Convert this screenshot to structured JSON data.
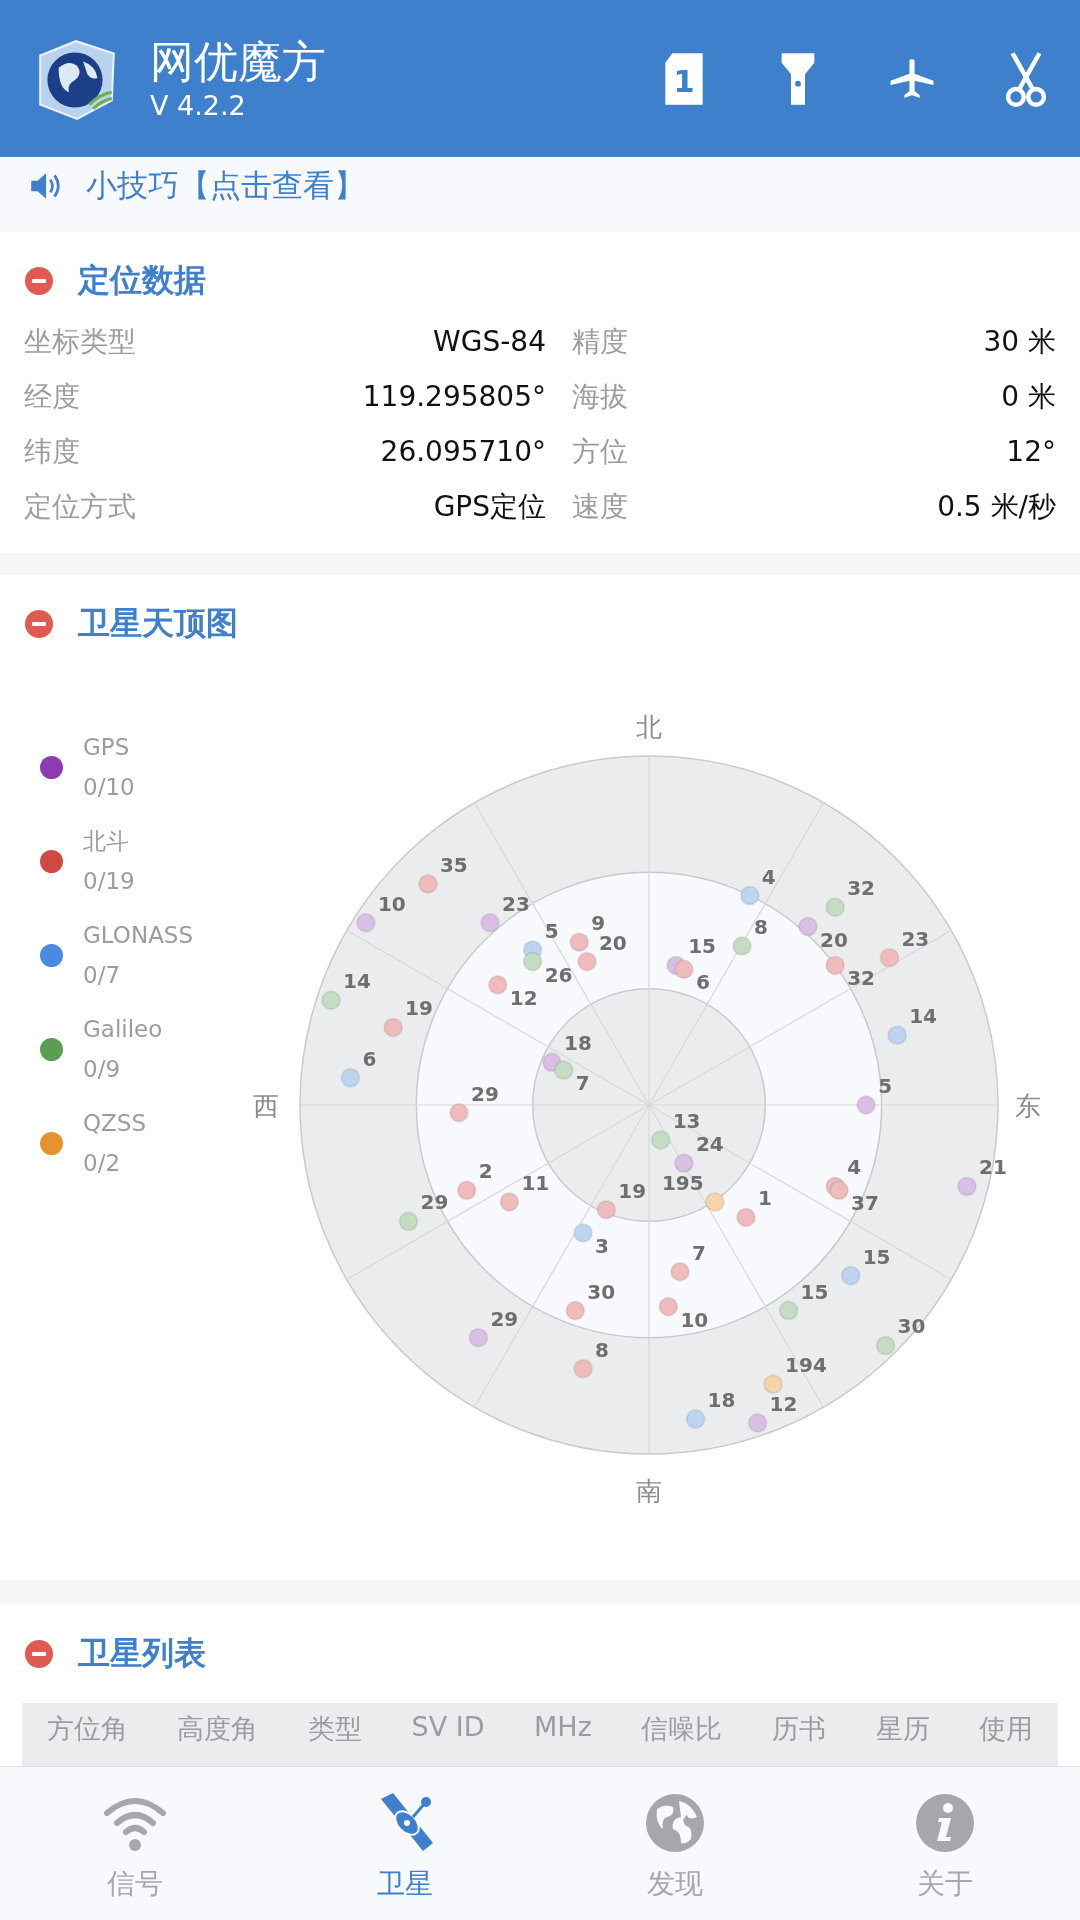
{
  "app": {
    "title": "网优魔方",
    "version": "V 4.2.2",
    "sim_label": "1"
  },
  "tip": {
    "text": "小技巧【点击查看】"
  },
  "location": {
    "title": "定位数据",
    "expanded": true,
    "rows": [
      {
        "label": "坐标类型",
        "value": "WGS-84",
        "label_2": "精度",
        "value_2": "30 米"
      },
      {
        "label": "经度",
        "value": "119.295805°",
        "label_2": "海拔",
        "value_2": "0 米"
      },
      {
        "label": "纬度",
        "value": "26.095710°",
        "label_2": "方位",
        "value_2": "12°"
      },
      {
        "label": "定位方式",
        "value": "GPS定位",
        "label_2": "速度",
        "value_2": "0.5 米/秒"
      }
    ]
  },
  "skyplot": {
    "title": "卫星天顶图",
    "expanded": true,
    "compass": {
      "north": "北",
      "east": "东",
      "south": "南",
      "west": "西"
    },
    "legend": [
      {
        "name": "GPS",
        "count": "0/10",
        "color": "#8e3ab0"
      },
      {
        "name": "北斗",
        "count": "0/19",
        "color": "#d04a44"
      },
      {
        "name": "GLONASS",
        "count": "0/7",
        "color": "#4a8ae0"
      },
      {
        "name": "Galileo",
        "count": "0/9",
        "color": "#5a9e52"
      },
      {
        "name": "QZSS",
        "count": "0/2",
        "color": "#e8912f"
      }
    ],
    "satellites": [
      {
        "label": "10",
        "color": "#d9bfe3"
      },
      {
        "label": "23",
        "color": "#d9bfe3"
      },
      {
        "label": "15",
        "color": "#d9bfe3"
      },
      {
        "label": "20",
        "color": "#d9bfe3"
      },
      {
        "label": "18",
        "color": "#d9bfe3"
      },
      {
        "label": "5",
        "color": "#d9bfe3"
      },
      {
        "label": "24",
        "color": "#d9bfe3"
      },
      {
        "label": "21",
        "color": "#d9bfe3"
      },
      {
        "label": "29",
        "color": "#d9bfe3"
      },
      {
        "label": "12",
        "color": "#d9bfe3"
      },
      {
        "label": "35",
        "color": "#efbcbb"
      },
      {
        "label": "19",
        "color": "#efbcbb"
      },
      {
        "label": "12",
        "color": "#efbcbb"
      },
      {
        "label": "9",
        "color": "#efbcbb"
      },
      {
        "label": "20",
        "color": "#efbcbb"
      },
      {
        "label": "6",
        "color": "#efbcbb"
      },
      {
        "label": "32",
        "color": "#efbcbb"
      },
      {
        "label": "23",
        "color": "#efbcbb"
      },
      {
        "label": "29",
        "color": "#efbcbb"
      },
      {
        "label": "2",
        "color": "#efbcbb"
      },
      {
        "label": "11",
        "color": "#efbcbb"
      },
      {
        "label": "19",
        "color": "#efbcbb"
      },
      {
        "label": "1",
        "color": "#efbcbb"
      },
      {
        "label": "4",
        "color": "#efbcbb"
      },
      {
        "label": "37",
        "color": "#efbcbb"
      },
      {
        "label": "7",
        "color": "#efbcbb"
      },
      {
        "label": "10",
        "color": "#efbcbb"
      },
      {
        "label": "30",
        "color": "#efbcbb"
      },
      {
        "label": "8",
        "color": "#efbcbb"
      },
      {
        "label": "4",
        "color": "#bcd4f2"
      },
      {
        "label": "5",
        "color": "#bcd4f2"
      },
      {
        "label": "14",
        "color": "#bcd4f2"
      },
      {
        "label": "6",
        "color": "#bcd4f2"
      },
      {
        "label": "3",
        "color": "#bcd4f2"
      },
      {
        "label": "15",
        "color": "#bcd4f2"
      },
      {
        "label": "18",
        "color": "#bcd4f2"
      },
      {
        "label": "32",
        "color": "#c4dcc0"
      },
      {
        "label": "8",
        "color": "#c4dcc0"
      },
      {
        "label": "26",
        "color": "#c4dcc0"
      },
      {
        "label": "14",
        "color": "#c4dcc0"
      },
      {
        "label": "7",
        "color": "#c4dcc0"
      },
      {
        "label": "13",
        "color": "#c4dcc0"
      },
      {
        "label": "29",
        "color": "#c4dcc0"
      },
      {
        "label": "15",
        "color": "#c4dcc0"
      },
      {
        "label": "30",
        "color": "#c4dcc0"
      },
      {
        "label": "195",
        "color": "#f5d3ad"
      },
      {
        "label": "194",
        "color": "#f5d3ad"
      }
    ]
  },
  "satellite_list": {
    "title": "卫星列表",
    "expanded": true,
    "columns": [
      "方位角",
      "高度角",
      "类型",
      "SV ID",
      "MHz",
      "信噪比",
      "历书",
      "星历",
      "使用"
    ]
  },
  "bottom_nav": [
    {
      "label": "信号",
      "kind": "wifi",
      "selected": false
    },
    {
      "label": "卫星",
      "kind": "satellite",
      "selected": true
    },
    {
      "label": "发现",
      "kind": "globe",
      "selected": false
    },
    {
      "label": "关于",
      "kind": "info",
      "selected": false
    }
  ]
}
